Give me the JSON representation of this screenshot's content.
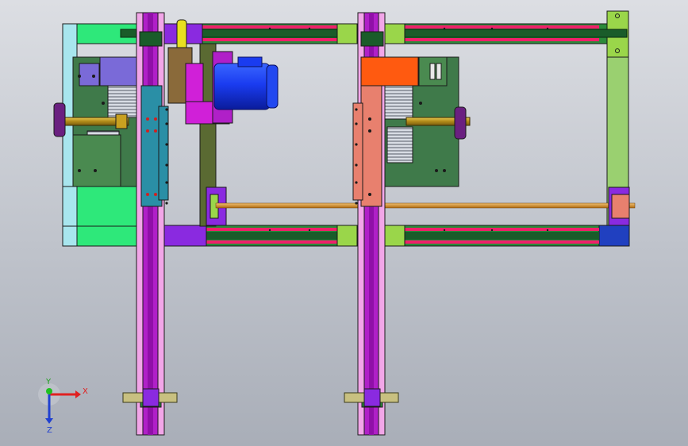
{
  "view": {
    "type": "cad-assembly-top-view",
    "background": [
      "#dcdee3",
      "#a9aeb8"
    ]
  },
  "triad": {
    "x_label": "X",
    "y_label": "Y",
    "z_label": "Z",
    "x_color": "#e02020",
    "y_color": "#20c020",
    "z_color": "#2040d0"
  },
  "colors": {
    "frame_green": "#2ee87a",
    "frame_light": "#a8e6ee",
    "rail_green": "#2b8a3a",
    "rail_pink": "#f0206a",
    "rail_dark": "#1a5c2a",
    "column_pink": "#f2a6e8",
    "column_violet": "#b020c8",
    "carriage_teal": "#2a8fa6",
    "carriage_salmon": "#e8806e",
    "block_orange": "#ff5a10",
    "block_purple": "#7a6ad8",
    "plate_green": "#3f7a4a",
    "plate_olive": "#6a8a3a",
    "motor_blue": "#2248f0",
    "mount_magenta": "#d020d8",
    "shaft_gold": "#c8a020",
    "shaft_orange": "#e0a040",
    "wheel_purple": "#6a2080",
    "belt_olive": "#5a6a32",
    "side_lime": "#9ad070",
    "corner_blue": "#2040c0",
    "lime_block": "#9ad64a",
    "purple_bar": "#8a2ae0"
  }
}
